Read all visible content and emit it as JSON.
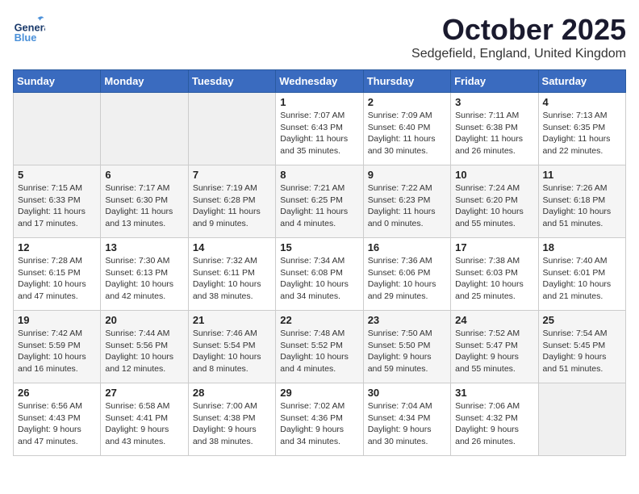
{
  "header": {
    "logo_general": "General",
    "logo_blue": "Blue",
    "month_title": "October 2025",
    "location": "Sedgefield, England, United Kingdom"
  },
  "weekdays": [
    "Sunday",
    "Monday",
    "Tuesday",
    "Wednesday",
    "Thursday",
    "Friday",
    "Saturday"
  ],
  "weeks": [
    [
      {
        "day": "",
        "info": ""
      },
      {
        "day": "",
        "info": ""
      },
      {
        "day": "",
        "info": ""
      },
      {
        "day": "1",
        "info": "Sunrise: 7:07 AM\nSunset: 6:43 PM\nDaylight: 11 hours\nand 35 minutes."
      },
      {
        "day": "2",
        "info": "Sunrise: 7:09 AM\nSunset: 6:40 PM\nDaylight: 11 hours\nand 30 minutes."
      },
      {
        "day": "3",
        "info": "Sunrise: 7:11 AM\nSunset: 6:38 PM\nDaylight: 11 hours\nand 26 minutes."
      },
      {
        "day": "4",
        "info": "Sunrise: 7:13 AM\nSunset: 6:35 PM\nDaylight: 11 hours\nand 22 minutes."
      }
    ],
    [
      {
        "day": "5",
        "info": "Sunrise: 7:15 AM\nSunset: 6:33 PM\nDaylight: 11 hours\nand 17 minutes."
      },
      {
        "day": "6",
        "info": "Sunrise: 7:17 AM\nSunset: 6:30 PM\nDaylight: 11 hours\nand 13 minutes."
      },
      {
        "day": "7",
        "info": "Sunrise: 7:19 AM\nSunset: 6:28 PM\nDaylight: 11 hours\nand 9 minutes."
      },
      {
        "day": "8",
        "info": "Sunrise: 7:21 AM\nSunset: 6:25 PM\nDaylight: 11 hours\nand 4 minutes."
      },
      {
        "day": "9",
        "info": "Sunrise: 7:22 AM\nSunset: 6:23 PM\nDaylight: 11 hours\nand 0 minutes."
      },
      {
        "day": "10",
        "info": "Sunrise: 7:24 AM\nSunset: 6:20 PM\nDaylight: 10 hours\nand 55 minutes."
      },
      {
        "day": "11",
        "info": "Sunrise: 7:26 AM\nSunset: 6:18 PM\nDaylight: 10 hours\nand 51 minutes."
      }
    ],
    [
      {
        "day": "12",
        "info": "Sunrise: 7:28 AM\nSunset: 6:15 PM\nDaylight: 10 hours\nand 47 minutes."
      },
      {
        "day": "13",
        "info": "Sunrise: 7:30 AM\nSunset: 6:13 PM\nDaylight: 10 hours\nand 42 minutes."
      },
      {
        "day": "14",
        "info": "Sunrise: 7:32 AM\nSunset: 6:11 PM\nDaylight: 10 hours\nand 38 minutes."
      },
      {
        "day": "15",
        "info": "Sunrise: 7:34 AM\nSunset: 6:08 PM\nDaylight: 10 hours\nand 34 minutes."
      },
      {
        "day": "16",
        "info": "Sunrise: 7:36 AM\nSunset: 6:06 PM\nDaylight: 10 hours\nand 29 minutes."
      },
      {
        "day": "17",
        "info": "Sunrise: 7:38 AM\nSunset: 6:03 PM\nDaylight: 10 hours\nand 25 minutes."
      },
      {
        "day": "18",
        "info": "Sunrise: 7:40 AM\nSunset: 6:01 PM\nDaylight: 10 hours\nand 21 minutes."
      }
    ],
    [
      {
        "day": "19",
        "info": "Sunrise: 7:42 AM\nSunset: 5:59 PM\nDaylight: 10 hours\nand 16 minutes."
      },
      {
        "day": "20",
        "info": "Sunrise: 7:44 AM\nSunset: 5:56 PM\nDaylight: 10 hours\nand 12 minutes."
      },
      {
        "day": "21",
        "info": "Sunrise: 7:46 AM\nSunset: 5:54 PM\nDaylight: 10 hours\nand 8 minutes."
      },
      {
        "day": "22",
        "info": "Sunrise: 7:48 AM\nSunset: 5:52 PM\nDaylight: 10 hours\nand 4 minutes."
      },
      {
        "day": "23",
        "info": "Sunrise: 7:50 AM\nSunset: 5:50 PM\nDaylight: 9 hours\nand 59 minutes."
      },
      {
        "day": "24",
        "info": "Sunrise: 7:52 AM\nSunset: 5:47 PM\nDaylight: 9 hours\nand 55 minutes."
      },
      {
        "day": "25",
        "info": "Sunrise: 7:54 AM\nSunset: 5:45 PM\nDaylight: 9 hours\nand 51 minutes."
      }
    ],
    [
      {
        "day": "26",
        "info": "Sunrise: 6:56 AM\nSunset: 4:43 PM\nDaylight: 9 hours\nand 47 minutes."
      },
      {
        "day": "27",
        "info": "Sunrise: 6:58 AM\nSunset: 4:41 PM\nDaylight: 9 hours\nand 43 minutes."
      },
      {
        "day": "28",
        "info": "Sunrise: 7:00 AM\nSunset: 4:38 PM\nDaylight: 9 hours\nand 38 minutes."
      },
      {
        "day": "29",
        "info": "Sunrise: 7:02 AM\nSunset: 4:36 PM\nDaylight: 9 hours\nand 34 minutes."
      },
      {
        "day": "30",
        "info": "Sunrise: 7:04 AM\nSunset: 4:34 PM\nDaylight: 9 hours\nand 30 minutes."
      },
      {
        "day": "31",
        "info": "Sunrise: 7:06 AM\nSunset: 4:32 PM\nDaylight: 9 hours\nand 26 minutes."
      },
      {
        "day": "",
        "info": ""
      }
    ]
  ]
}
